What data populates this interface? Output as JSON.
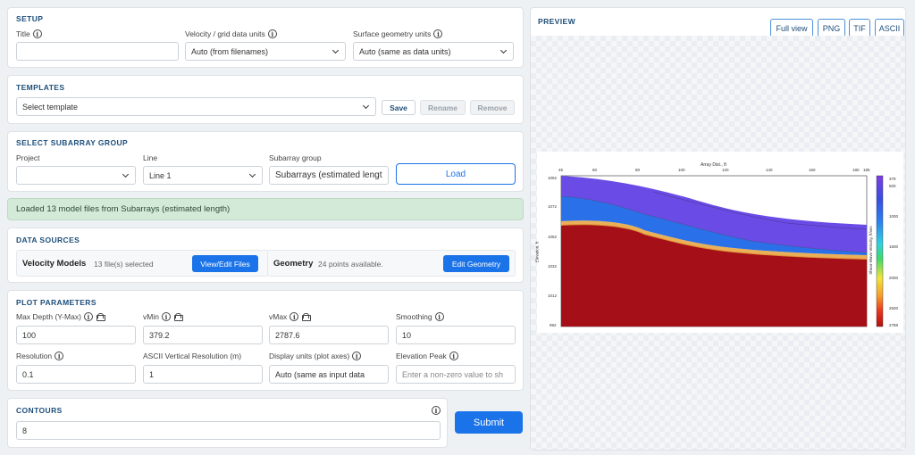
{
  "setup": {
    "title": "SETUP",
    "title_label": "Title",
    "title_value": "",
    "velocity_units_label": "Velocity / grid data units",
    "velocity_units_value": "Auto (from filenames)",
    "surface_units_label": "Surface geometry units",
    "surface_units_value": "Auto (same as data units)"
  },
  "templates": {
    "title": "TEMPLATES",
    "select_placeholder": "Select template",
    "save": "Save",
    "rename": "Rename",
    "remove": "Remove"
  },
  "subarray": {
    "title": "SELECT SUBARRAY GROUP",
    "project_label": "Project",
    "project_value": "",
    "line_label": "Line",
    "line_value": "Line 1",
    "group_label": "Subarray group",
    "group_value": "Subarrays (estimated lengt",
    "load": "Load"
  },
  "status": {
    "message": "Loaded 13 model files from Subarrays (estimated length)"
  },
  "data_sources": {
    "title": "DATA SOURCES",
    "velocity_title": "Velocity Models",
    "velocity_info": "13 file(s) selected",
    "velocity_button": "View/Edit Files",
    "geometry_title": "Geometry",
    "geometry_info": "24 points available.",
    "geometry_button": "Edit Geometry"
  },
  "plot_params": {
    "title": "PLOT PARAMETERS",
    "max_depth_label": "Max Depth (Y-Max)",
    "max_depth_value": "100",
    "vmin_label": "vMin",
    "vmin_value": "379.2",
    "vmax_label": "vMax",
    "vmax_value": "2787.6",
    "smoothing_label": "Smoothing",
    "smoothing_value": "10",
    "resolution_label": "Resolution",
    "resolution_value": "0.1",
    "ascii_res_label": "ASCII Vertical Resolution (m)",
    "ascii_res_value": "1",
    "display_units_label": "Display units (plot axes)",
    "display_units_value": "Auto (same as input data",
    "elevation_peak_label": "Elevation Peak",
    "elevation_peak_placeholder": "Enter a non-zero value to sh"
  },
  "contours": {
    "title": "CONTOURS",
    "value": "8"
  },
  "submit": "Submit",
  "preview": {
    "title": "PREVIEW",
    "buttons": [
      "Full view",
      "PNG",
      "TIF",
      "ASCII"
    ],
    "plot": {
      "x_title": "Array Dist., ft",
      "x_ticks": [
        "45",
        "60",
        "80",
        "100",
        "120",
        "140",
        "160",
        "180",
        "185"
      ],
      "y_title": "Elevation, ft",
      "y_ticks": [
        "1092",
        "1072",
        "1052",
        "1032",
        "1012",
        "992"
      ],
      "cb_title": "Shear-Wave Velocity, ft/sec",
      "cb_ticks": [
        "379",
        "500",
        "1000",
        "1500",
        "2000",
        "2500",
        "2788"
      ]
    }
  },
  "colors": {
    "accent": "#1a73e8",
    "section_title": "#1d4e7a",
    "status_bg": "#d4ead9"
  }
}
